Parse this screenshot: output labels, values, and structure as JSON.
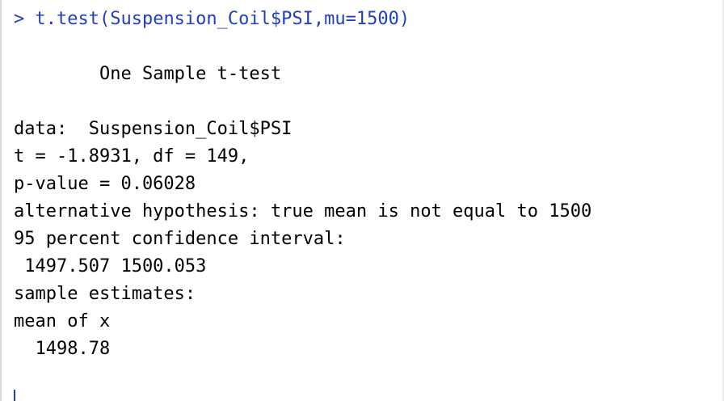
{
  "console": {
    "prompt": ">",
    "command": "t.test(Suspension_Coil$PSI,mu=1500)",
    "output": {
      "title": "One Sample t-test",
      "data_line": "data:  Suspension_Coil$PSI",
      "t_line": "t = -1.8931, df = 149,",
      "p_line": "p-value = 0.06028",
      "alternative_line": "alternative hypothesis: true mean is not equal to 1500",
      "ci_header": "95 percent confidence interval:",
      "ci_values": " 1497.507 1500.053",
      "estimates_header": "sample estimates:",
      "mean_header": "mean of x",
      "mean_value": "  1498.78"
    }
  },
  "colors": {
    "command": "#1f3fbf",
    "output": "#000000",
    "background": "#ffffff"
  }
}
